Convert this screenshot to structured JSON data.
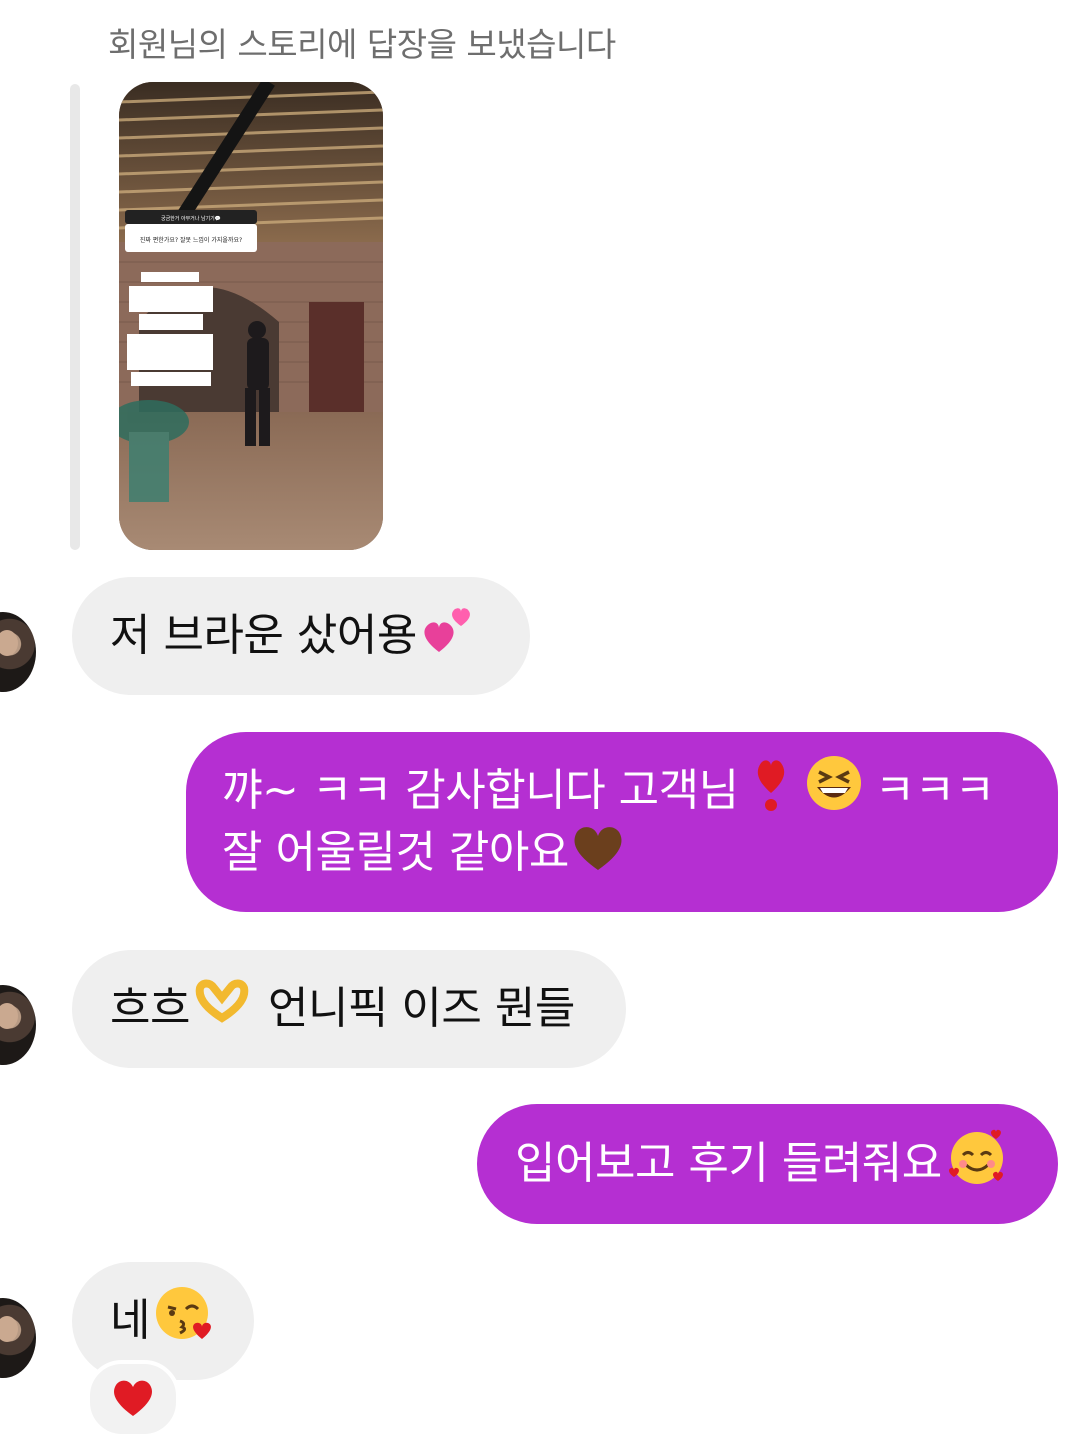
{
  "system_note": "회원님의 스토리에 답장을 보냈습니다",
  "story": {
    "sticker_title": "궁금한거 아무거나 남기기💬",
    "sticker_question": "진짜 편한가요? 잘못 느낌이 가지올까요?"
  },
  "messages": [
    {
      "id": "m1",
      "from": "them",
      "text": "저 브라운 샀어용",
      "emoji": "two-hearts"
    },
    {
      "id": "m2",
      "from": "me",
      "line1": "꺄~ ㅋㅋ 감사합니다 고객님",
      "line1_tail": "ㅋㅋㅋ",
      "line2": "잘 어울릴것 같아요",
      "emoji1": "red-exclamation",
      "emoji2": "grinning-squinting-face",
      "emoji3": "brown-heart"
    },
    {
      "id": "m3",
      "from": "them",
      "text_before": "흐흐",
      "text_after": "언니픽 이즈 뭔들",
      "emoji": "heart-hands"
    },
    {
      "id": "m4",
      "from": "me",
      "text": "입어보고 후기 들려줘요",
      "emoji": "smiling-face-with-hearts"
    },
    {
      "id": "m5",
      "from": "them",
      "text": "네",
      "emoji": "face-blowing-kiss",
      "reaction": "red-heart"
    }
  ],
  "colors": {
    "outgoing": "#b52fd2",
    "incoming": "#efefef",
    "reaction": "#f2f2f2"
  }
}
